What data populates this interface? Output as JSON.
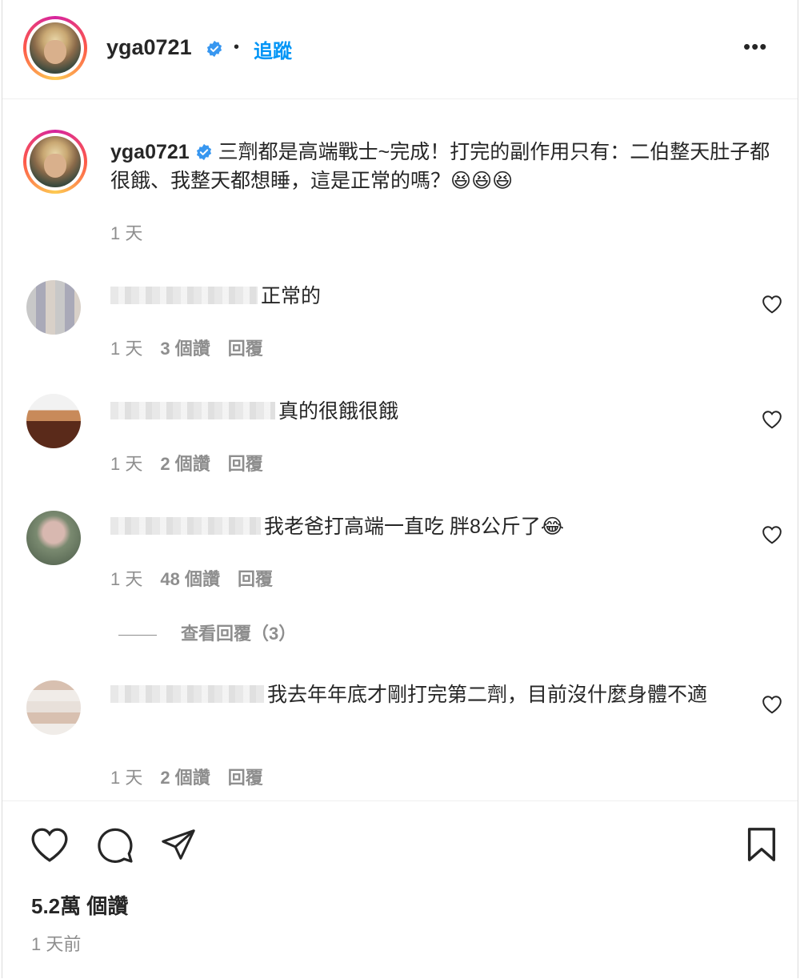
{
  "post": {
    "username": "yga0721",
    "follow_label": "追蹤",
    "dot": "•",
    "more_label": "•••"
  },
  "caption": {
    "username": "yga0721",
    "text": "三劑都是高端戰士~完成！打完的副作用只有：二伯整天肚子都很餓、我整天都想睡，這是正常的嗎？😆😆😆",
    "time": "1 天"
  },
  "comments": [
    {
      "text": "正常的",
      "time": "1 天",
      "likes": "3 個讚",
      "reply": "回覆"
    },
    {
      "text": "真的很餓很餓",
      "time": "1 天",
      "likes": "2 個讚",
      "reply": "回覆"
    },
    {
      "text": "我老爸打高端一直吃 胖8公斤了😂",
      "time": "1 天",
      "likes": "48 個讚",
      "reply": "回覆"
    },
    {
      "text": "我去年年底才剛打完第二劑，目前沒什麼身體不適",
      "time": "1 天",
      "likes": "2 個讚",
      "reply": "回覆"
    }
  ],
  "view_replies": "查看回覆（3）",
  "footer": {
    "likes_total": "5.2萬 個讚",
    "time_ago": "1 天前"
  },
  "colors": {
    "accent": "#0095f6",
    "verified": "#3897f0",
    "muted": "#8e8e8e"
  }
}
